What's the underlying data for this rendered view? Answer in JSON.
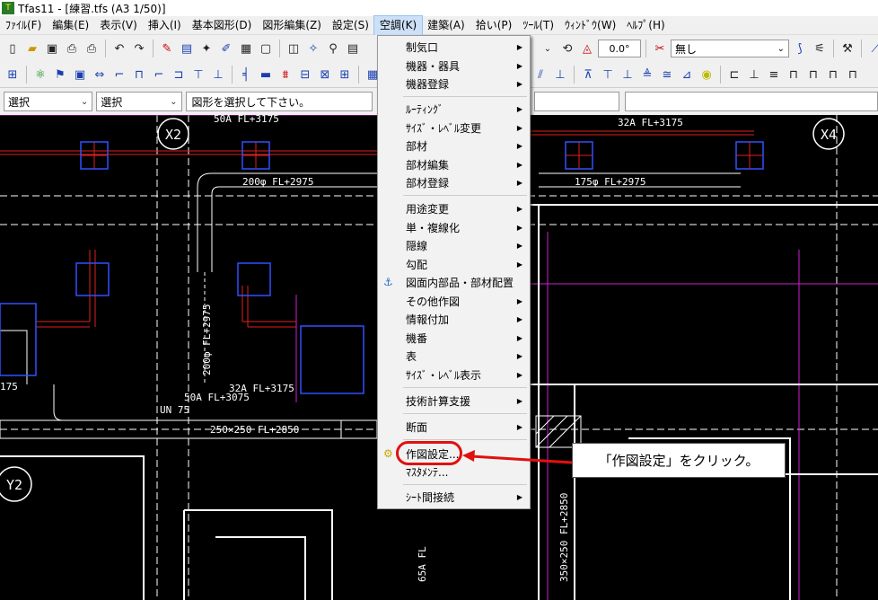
{
  "window": {
    "title": "Tfas11 - [練習.tfs (A3 1/50)]",
    "app_icon": "tfas-icon"
  },
  "menubar": [
    "ﾌｧｲﾙ(F)",
    "編集(E)",
    "表示(V)",
    "挿入(I)",
    "基本図形(D)",
    "図形編集(Z)",
    "設定(S)",
    "空調(K)",
    "建築(A)",
    "拾い(P)",
    "ﾂｰﾙ(T)",
    "ｳｨﾝﾄﾞｳ(W)",
    "ﾍﾙﾌﾟ(H)"
  ],
  "active_menu": "空調(K)",
  "propbar": {
    "select1": "選択",
    "select2": "選択",
    "status": "図形を選択して下さい。"
  },
  "toolbar": {
    "angle": "0.0°",
    "linetype": "無し"
  },
  "dropdown": {
    "items": [
      {
        "label": "制気口",
        "sub": true
      },
      {
        "label": "機器・器具",
        "sub": true
      },
      {
        "label": "機器登録",
        "sub": true
      },
      {
        "label": "ﾙｰﾃｨﾝｸﾞ",
        "sub": true
      },
      {
        "label": "ｻｲｽﾞ・ﾚﾍﾞﾙ変更",
        "sub": true
      },
      {
        "label": "部材",
        "sub": true
      },
      {
        "label": "部材編集",
        "sub": true
      },
      {
        "label": "部材登録",
        "sub": true
      },
      {
        "label": "用途変更",
        "sub": true
      },
      {
        "label": "単・複線化",
        "sub": true
      },
      {
        "label": "隠線",
        "sub": true
      },
      {
        "label": "勾配",
        "sub": true
      },
      {
        "label": "図面内部品・部材配置",
        "sub": false
      },
      {
        "label": "その他作図",
        "sub": true
      },
      {
        "label": "情報付加",
        "sub": true
      },
      {
        "label": "機番",
        "sub": true
      },
      {
        "label": "表",
        "sub": true
      },
      {
        "label": "ｻｲｽﾞ・ﾚﾍﾞﾙ表示",
        "sub": true
      },
      {
        "label": "技術計算支援",
        "sub": true
      },
      {
        "label": "断面",
        "sub": true
      },
      {
        "label": "作図設定...",
        "sub": false
      },
      {
        "label": "ﾏｽﾀﾒﾝﾃ...",
        "sub": false
      },
      {
        "label": "ｼｰﾄ間接続",
        "sub": true
      }
    ],
    "submenu_arrow": "▶"
  },
  "callout": {
    "text": "「作図設定」をクリック。",
    "highlight_color": "#e01010"
  },
  "cad": {
    "grid_labels": [
      "X2",
      "X4",
      "Y2"
    ],
    "annotations": [
      "50A  FL+3175",
      "32A  FL+3175",
      "200φ  FL+2975",
      "175φ  FL+2975",
      "200φ  FL+2975",
      "32A  FL+3175",
      "50A  FL+3075",
      "250×250  FL+2850",
      "65A  FL",
      "350×250  FL+2850",
      "175",
      "UN 75"
    ]
  }
}
